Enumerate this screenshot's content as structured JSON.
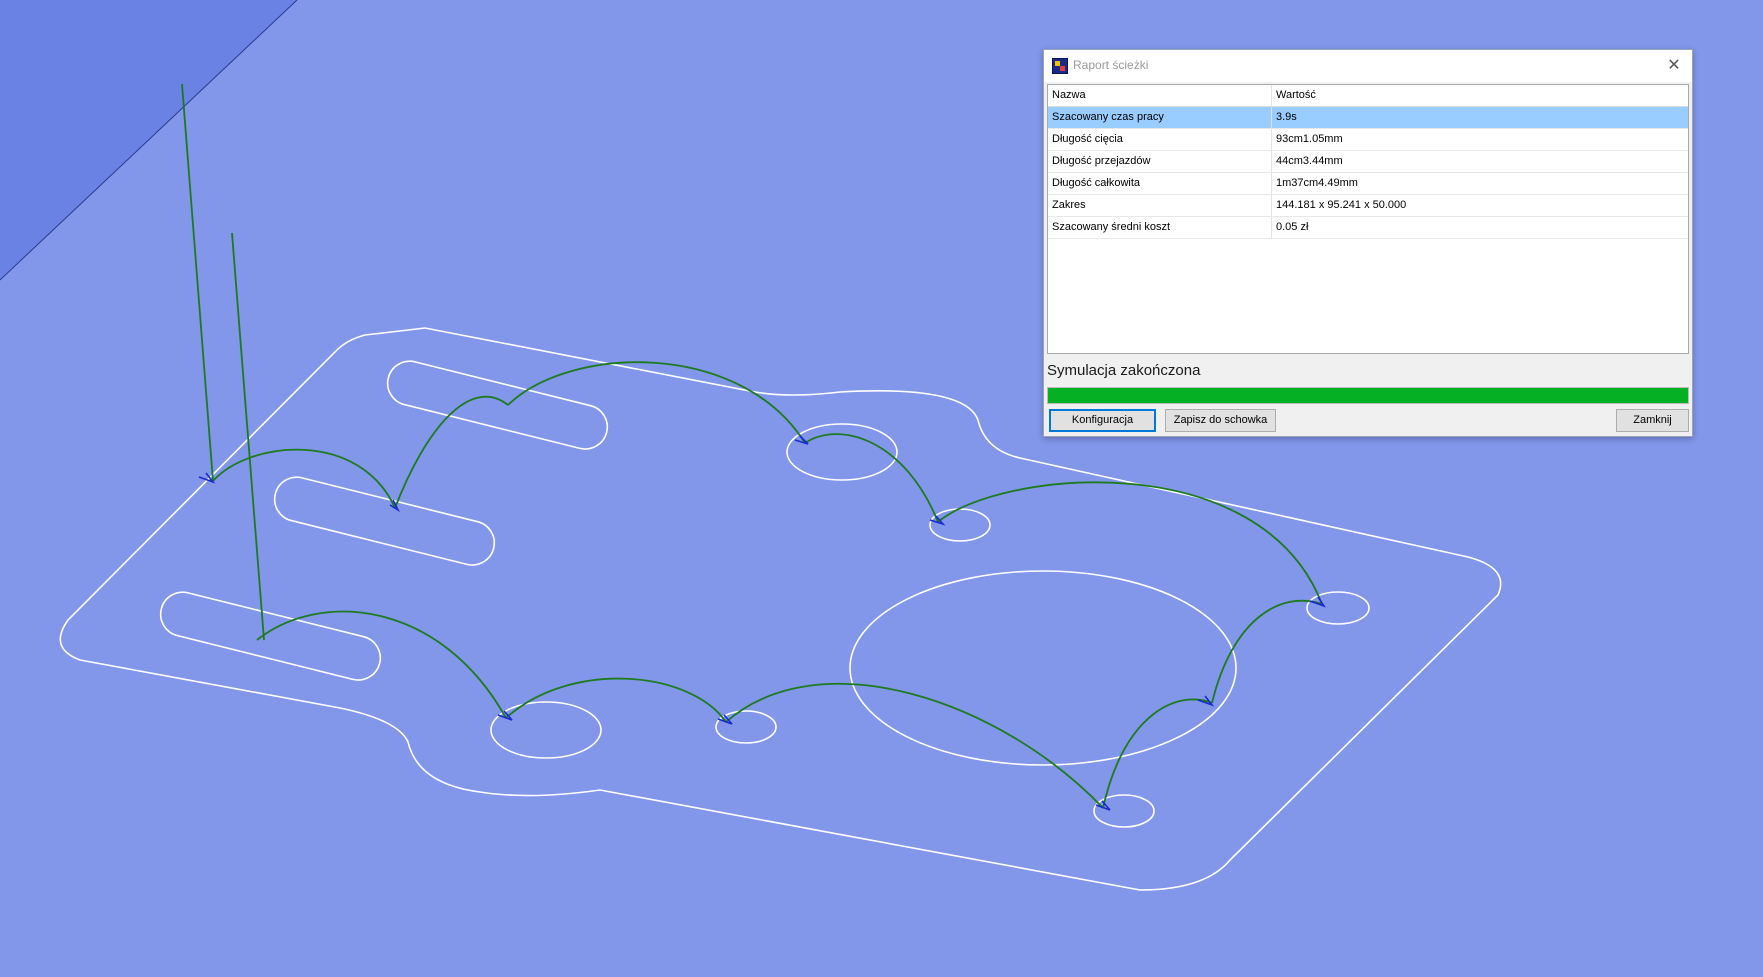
{
  "dialog": {
    "title": "Raport ścieżki",
    "close_glyph": "✕",
    "icon": "app-icon"
  },
  "table": {
    "headers": [
      "Nazwa",
      "Wartość"
    ],
    "rows": [
      {
        "name": "Szacowany czas pracy",
        "value": "3.9s"
      },
      {
        "name": "Długość cięcia",
        "value": "93cm1.05mm"
      },
      {
        "name": "Długość przejazdów",
        "value": "44cm3.44mm"
      },
      {
        "name": "Długość całkowita",
        "value": "1m37cm4.49mm"
      },
      {
        "name": "Zakres",
        "value": "144.181 x 95.241 x 50.000"
      },
      {
        "name": "Szacowany średni koszt",
        "value": "0.05 zł"
      }
    ],
    "selected_row": 0
  },
  "status": "Symulacja zakończona",
  "progress": 1.0,
  "buttons": {
    "config": "Konfiguracja",
    "copy": "Zapisz do schowka",
    "close": "Zamknij"
  },
  "colors": {
    "background": "#8296ea",
    "corner": "#6a82e4",
    "outline": "#ffffff",
    "travel_path": "#1e7a1e",
    "plunge_mark": "#1a2ad0",
    "progress": "#06b025",
    "selection": "#99ccff"
  }
}
